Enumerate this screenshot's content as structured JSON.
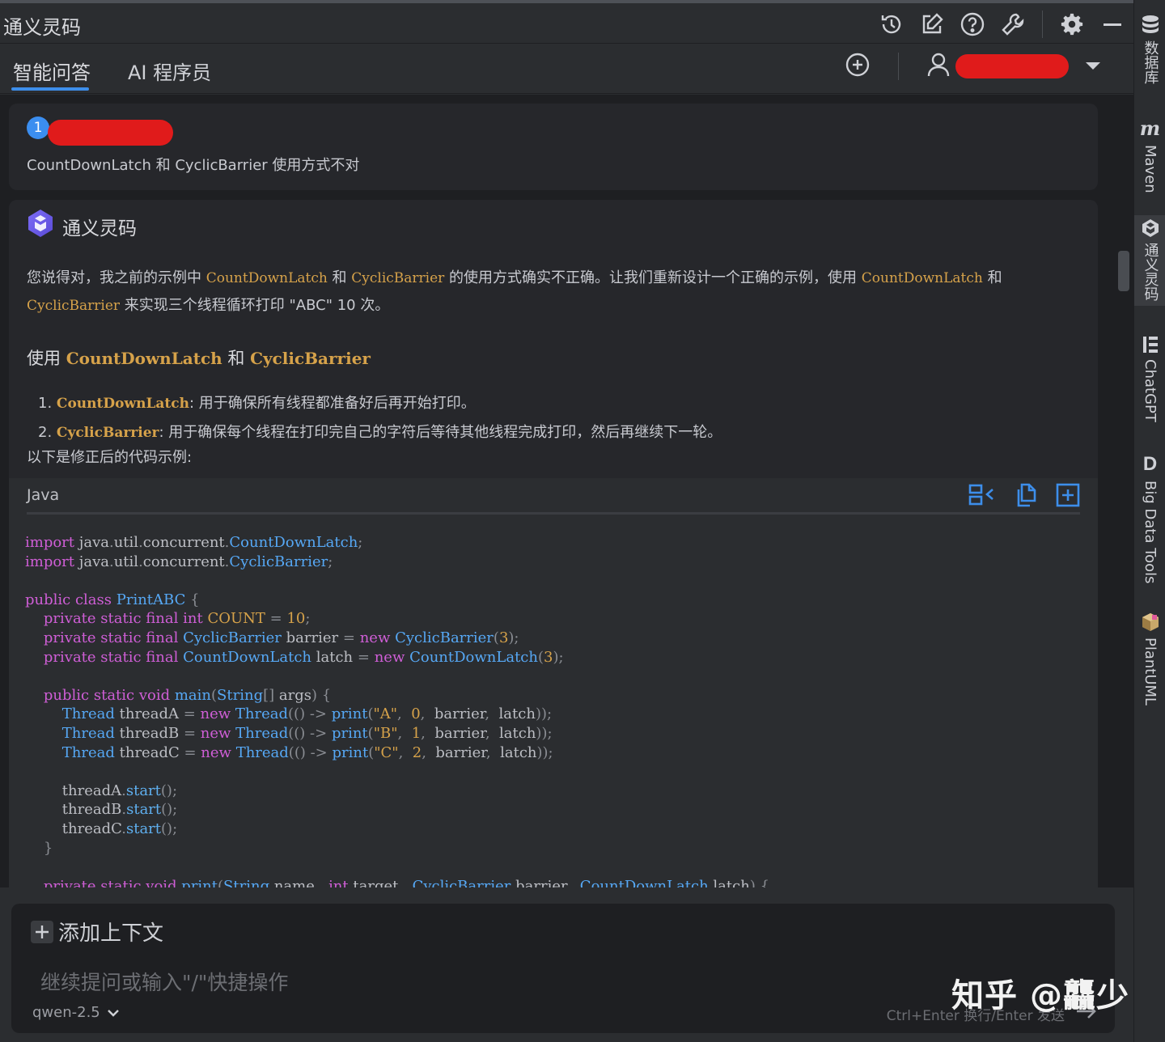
{
  "window": {
    "title": "通义灵码"
  },
  "tabs": [
    {
      "label": "智能问答",
      "active": true
    },
    {
      "label": "AI 程序员",
      "active": false
    }
  ],
  "question": {
    "number": "1",
    "text": "CountDownLatch 和 CyclicBarrier 使用方式不对"
  },
  "answer": {
    "assistant_name": "通义灵码",
    "para_1": "您说得对，我之前的示例中",
    "para_code_1": "CountDownLatch",
    "para_2": "和",
    "para_code_2": "CyclicBarrier",
    "para_3": "的使用方式确实不正确。让我们重新设计一个正确的示例，使用",
    "para_code_3": "CountDownLatch",
    "para_4": "和",
    "para_code_4": "CyclicBarrier",
    "para_5": "来实现三个线程循环打印 \"ABC\" 10 次。",
    "heading_prefix": "使用",
    "heading_code_1": "CountDownLatch",
    "heading_mid": "和",
    "heading_code_2": "CyclicBarrier",
    "list": [
      {
        "num": "1.",
        "code": "CountDownLatch",
        "text": ": 用于确保所有线程都准备好后再开始打印。"
      },
      {
        "num": "2.",
        "code": "CyclicBarrier",
        "text": ": 用于确保每个线程在打印完自己的字符后等待其他线程完成打印，然后再继续下一轮。"
      }
    ],
    "after_list": "以下是修正后的代码示例:"
  },
  "code_block": {
    "language": "Java"
  },
  "input": {
    "add_context": "添加上下文",
    "placeholder": "继续提问或输入\"/\"快捷操作",
    "model": "qwen-2.5",
    "hint": "Ctrl+Enter 换行/Enter 发送"
  },
  "watermark": "知乎 @龘少",
  "sidebar": [
    {
      "label": "数据库",
      "icon": "database-icon"
    },
    {
      "label": "Maven",
      "icon": "maven-icon"
    },
    {
      "label": "通义灵码",
      "icon": "tongyi-icon",
      "active": true
    },
    {
      "label": "ChatGPT",
      "icon": "chatgpt-icon"
    },
    {
      "label": "Big Data Tools",
      "icon": "bigdata-icon"
    },
    {
      "label": "PlantUML",
      "icon": "plantuml-icon"
    }
  ],
  "colors": {
    "accent": "#3d8eea",
    "code_keyword": "#cf5ed6",
    "code_type": "#56a8f5",
    "code_literal": "#d6a24a",
    "redaction": "#e01b1b"
  }
}
